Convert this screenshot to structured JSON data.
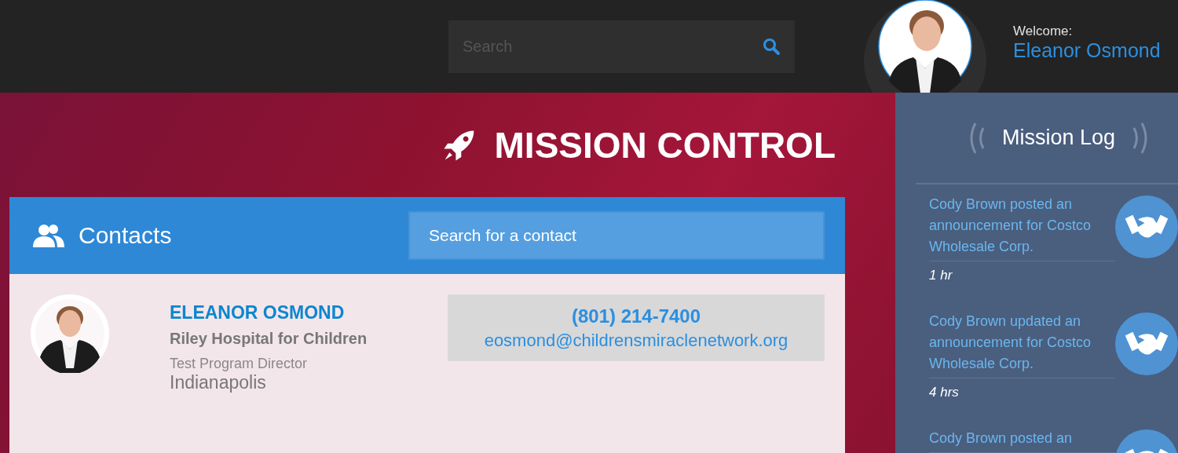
{
  "header": {
    "search": {
      "placeholder": "Search"
    },
    "welcome_label": "Welcome:",
    "user_name": "Eleanor Osmond"
  },
  "page_title": "MISSION CONTROL",
  "contacts": {
    "title": "Contacts",
    "search": {
      "placeholder": "Search for a contact"
    },
    "items": [
      {
        "name": "ELEANOR OSMOND",
        "organization": "Riley Hospital for Children",
        "role": "Test Program Director",
        "city": "Indianapolis",
        "phone": "(801) 214-7400",
        "email": "eosmond@childrensmiraclenetwork.org"
      }
    ]
  },
  "mission_log": {
    "title": "Mission Log",
    "entries": [
      {
        "text": "Cody Brown posted an announcement for Costco Wholesale Corp.",
        "time": "1 hr"
      },
      {
        "text": "Cody Brown updated an announcement for Costco Wholesale Corp.",
        "time": "4 hrs"
      },
      {
        "text": "Cody Brown posted an"
      }
    ]
  }
}
